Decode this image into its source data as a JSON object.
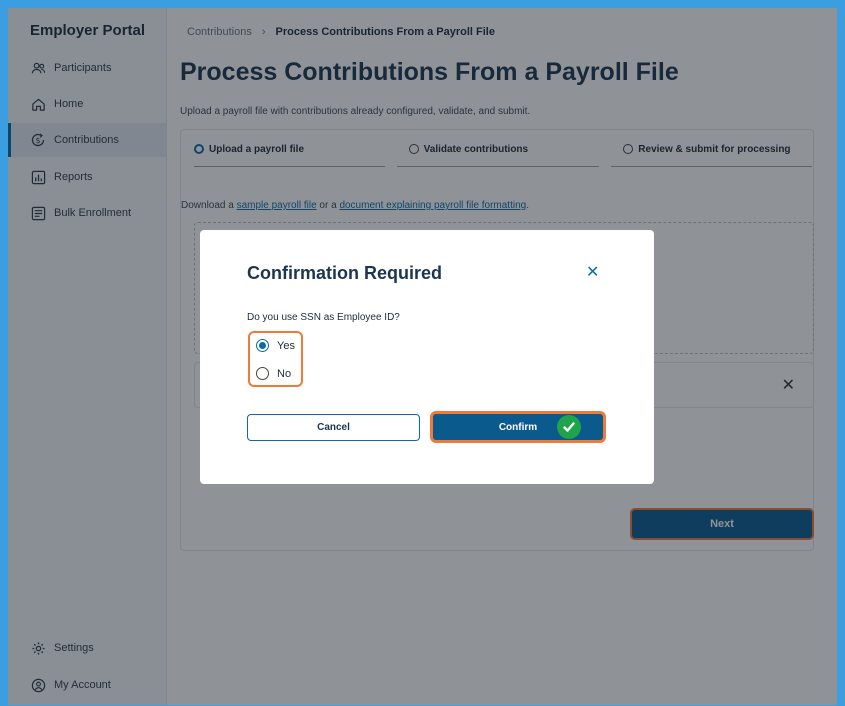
{
  "sidebar": {
    "brand": "Employer Portal",
    "items": [
      {
        "label": "Participants",
        "icon": "users-icon"
      },
      {
        "label": "Home",
        "icon": "home-icon"
      },
      {
        "label": "Contributions",
        "icon": "dollar-cycle-icon",
        "active": true
      },
      {
        "label": "Reports",
        "icon": "chart-icon"
      },
      {
        "label": "Bulk Enrollment",
        "icon": "list-icon"
      }
    ],
    "bottom_items": [
      {
        "label": "Settings",
        "icon": "gear-icon"
      },
      {
        "label": "My Account",
        "icon": "user-circle-icon"
      }
    ]
  },
  "breadcrumb": {
    "parent": "Contributions",
    "separator": "›",
    "current": "Process Contributions From a Payroll File"
  },
  "page": {
    "title": "Process Contributions From a Payroll File",
    "subtitle": "Upload a payroll file with contributions already configured, validate, and submit."
  },
  "steps": [
    {
      "label": "Upload a payroll file",
      "active": true
    },
    {
      "label": "Validate contributions",
      "active": false
    },
    {
      "label": "Review & submit for processing",
      "active": false
    }
  ],
  "download": {
    "prefix": "Download a ",
    "link1": "sample payroll file",
    "middle": " or a ",
    "link2": "document explaining payroll file formatting",
    "suffix": "."
  },
  "next_label": "Next",
  "modal": {
    "title": "Confirmation Required",
    "question": "Do you use SSN as Employee ID?",
    "options": [
      {
        "label": "Yes",
        "selected": true
      },
      {
        "label": "No",
        "selected": false
      }
    ],
    "cancel_label": "Cancel",
    "confirm_label": "Confirm"
  },
  "colors": {
    "accent": "#0b6ba8",
    "primary_button": "#0b5a8e",
    "highlight": "#f07a3c",
    "check": "#1ea44a"
  }
}
